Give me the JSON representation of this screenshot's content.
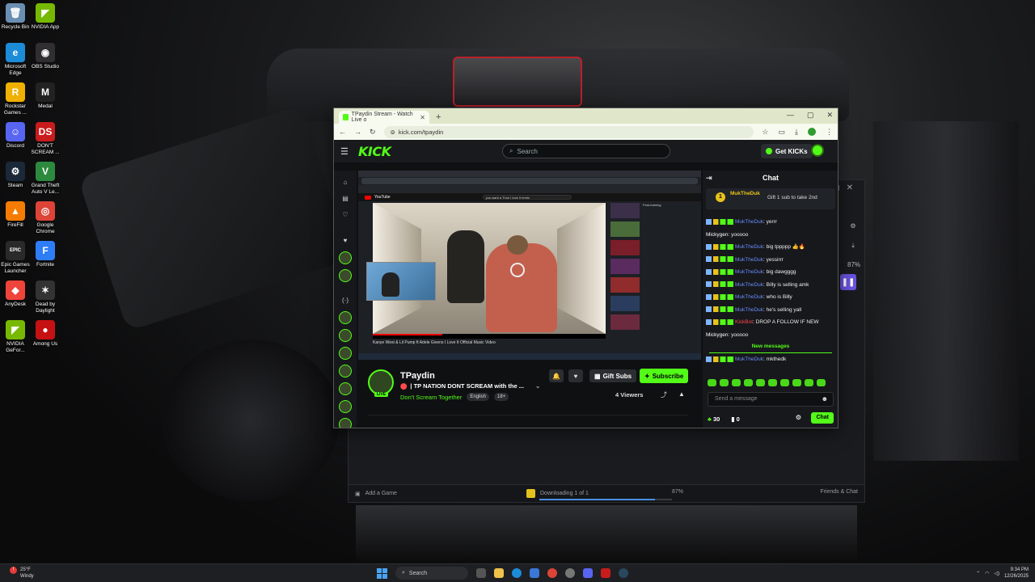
{
  "desktop_icons": [
    {
      "label": "Recycle Bin",
      "glyph": "🗑",
      "color": "#6b8fb3"
    },
    {
      "label": "NVIDIA App",
      "glyph": "◤",
      "color": "#76b900"
    },
    {
      "label": "Microsoft Edge",
      "glyph": "e",
      "color": "#1c8bd8"
    },
    {
      "label": "OBS Studio",
      "glyph": "◉",
      "color": "#302e31"
    },
    {
      "label": "Rockstar Games ...",
      "glyph": "R",
      "color": "#f0b000"
    },
    {
      "label": "Medal",
      "glyph": "M",
      "color": "#222"
    },
    {
      "label": "Discord",
      "glyph": "☺",
      "color": "#5865f2"
    },
    {
      "label": "DON'T SCREAM ...",
      "glyph": "DS",
      "color": "#c81c1c"
    },
    {
      "label": "Steam",
      "glyph": "⚙",
      "color": "#1b2838"
    },
    {
      "label": "Grand Theft Auto V Le...",
      "glyph": "V",
      "color": "#2b8a3e"
    },
    {
      "label": "FireFill",
      "glyph": "▲",
      "color": "#f57c00"
    },
    {
      "label": "Google Chrome",
      "glyph": "◎",
      "color": "#db4437"
    },
    {
      "label": "Epic Games Launcher",
      "glyph": "EPIC",
      "color": "#2a2a2a"
    },
    {
      "label": "Fortnite",
      "glyph": "F",
      "color": "#2e7cf6"
    },
    {
      "label": "AnyDesk",
      "glyph": "◆",
      "color": "#ef443b"
    },
    {
      "label": "Dead by Daylight",
      "glyph": "✶",
      "color": "#333"
    },
    {
      "label": "NVIDIA GeFor...",
      "glyph": "◤",
      "color": "#76b900"
    },
    {
      "label": "Among Us",
      "glyph": "●",
      "color": "#c51111"
    }
  ],
  "browser": {
    "tab_title": "TPaydin Stream - Watch Live o",
    "url": "kick.com/tpaydin"
  },
  "kick": {
    "logo": "KICK",
    "search_placeholder": "Search",
    "get_kicks": "Get KICKs"
  },
  "video": {
    "yt_search": "you want a Thon I love it remix",
    "yt_title": "Kanye West & Lil Pump ft Adele Givens I Love It Official Music Video",
    "overlay_text": "Post-training"
  },
  "stream": {
    "streamer": "TPaydin",
    "live": "LIVE",
    "title": "| TP NATION DONT SCREAM with the ...",
    "category": "Don't Scream Together",
    "tags": [
      "English",
      "18+"
    ],
    "gift_subs": "Gift Subs",
    "subscribe": "Subscribe",
    "viewers": "4 Viewers"
  },
  "chat": {
    "header": "Chat",
    "pinned_user": "MukTheDuk",
    "pinned_count": "1",
    "pinned_text": "Gift 1 sub to take 2nd",
    "messages": [
      {
        "user": "MukTheDuk",
        "text": ": yerrr",
        "badges": true,
        "color": "blue"
      },
      {
        "user": "Mickygen",
        "text": ": yooooo",
        "badges": false,
        "color": "white"
      },
      {
        "user": "MukTheDuk",
        "text": ": big tppppp 👍🔥",
        "badges": true,
        "color": "blue"
      },
      {
        "user": "MukTheDuk",
        "text": ": yessirrr",
        "badges": true,
        "color": "blue"
      },
      {
        "user": "MukTheDuk",
        "text": ": big dawgggg",
        "badges": true,
        "color": "blue"
      },
      {
        "user": "MukTheDuk",
        "text": ": Billy is selling amk",
        "badges": true,
        "color": "blue"
      },
      {
        "user": "MukTheDuk",
        "text": ": who is Billy",
        "badges": true,
        "color": "blue"
      },
      {
        "user": "MukTheDuk",
        "text": ": he's selling yall",
        "badges": true,
        "color": "blue"
      },
      {
        "user": "KickBot",
        "text": ": DROP A FOLLOW IF NEW",
        "badges": true,
        "color": "red"
      },
      {
        "user": "Mickygen",
        "text": ": yooooo",
        "badges": false,
        "color": "white"
      }
    ],
    "new_messages": "New messages",
    "after_messages": [
      {
        "user": "MukTheDuk",
        "text": ": mkthedk",
        "badges": true,
        "color": "blue"
      }
    ],
    "send_placeholder": "Send a message",
    "kicks_count": "30",
    "points_count": "0",
    "chat_button": "Chat"
  },
  "back_window": {
    "add_game": "Add a Game",
    "downloading": "Downloading 1 of 1",
    "download_progress": 0.87,
    "download_pct": "87%",
    "friends": "Friends & Chat",
    "side_pct": "87%"
  },
  "taskbar": {
    "weather_temp": "25°F",
    "weather_desc": "Windy",
    "search": "Search",
    "time": "9:34 PM",
    "date": "12/26/2025"
  }
}
